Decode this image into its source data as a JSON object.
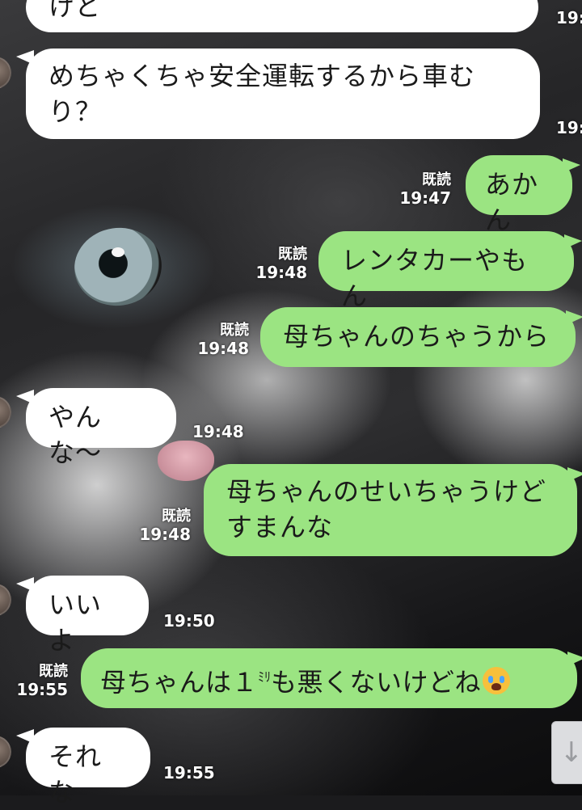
{
  "messages": [
    {
      "side": "in",
      "text": "けど",
      "time": "19:"
    },
    {
      "side": "in",
      "text": "めちゃくちゃ安全運転するから車むり？",
      "line1": "めちゃくちゃ安全運転するから車む",
      "line2": "り？",
      "time": "19:"
    },
    {
      "side": "out",
      "text": "あかん",
      "read": "既読",
      "time": "19:47"
    },
    {
      "side": "out",
      "text": "レンタカーやもん",
      "read": "既読",
      "time": "19:48"
    },
    {
      "side": "out",
      "text": "母ちゃんのちゃうから",
      "read": "既読",
      "time": "19:48"
    },
    {
      "side": "in",
      "text": "やんな〜",
      "time": "19:48"
    },
    {
      "side": "out",
      "text": "母ちゃんのせいちゃうけどすまんな",
      "line1": "母ちゃんのせいちゃうけど",
      "line2": "すまんな",
      "read": "既読",
      "time": "19:48"
    },
    {
      "side": "in",
      "text": "いいよ",
      "time": "19:50"
    },
    {
      "side": "out",
      "text_a": "母ちゃんは１",
      "text_unit": "ﾐﾘ",
      "text_b": "も悪くないけどね",
      "emoji": "loudly-crying-face-icon",
      "read": "既読",
      "time": "19:55"
    },
    {
      "side": "in",
      "text": "それな",
      "time": "19:55"
    }
  ],
  "scroll_button": {
    "icon": "arrow-down-icon",
    "glyph": "↓"
  }
}
